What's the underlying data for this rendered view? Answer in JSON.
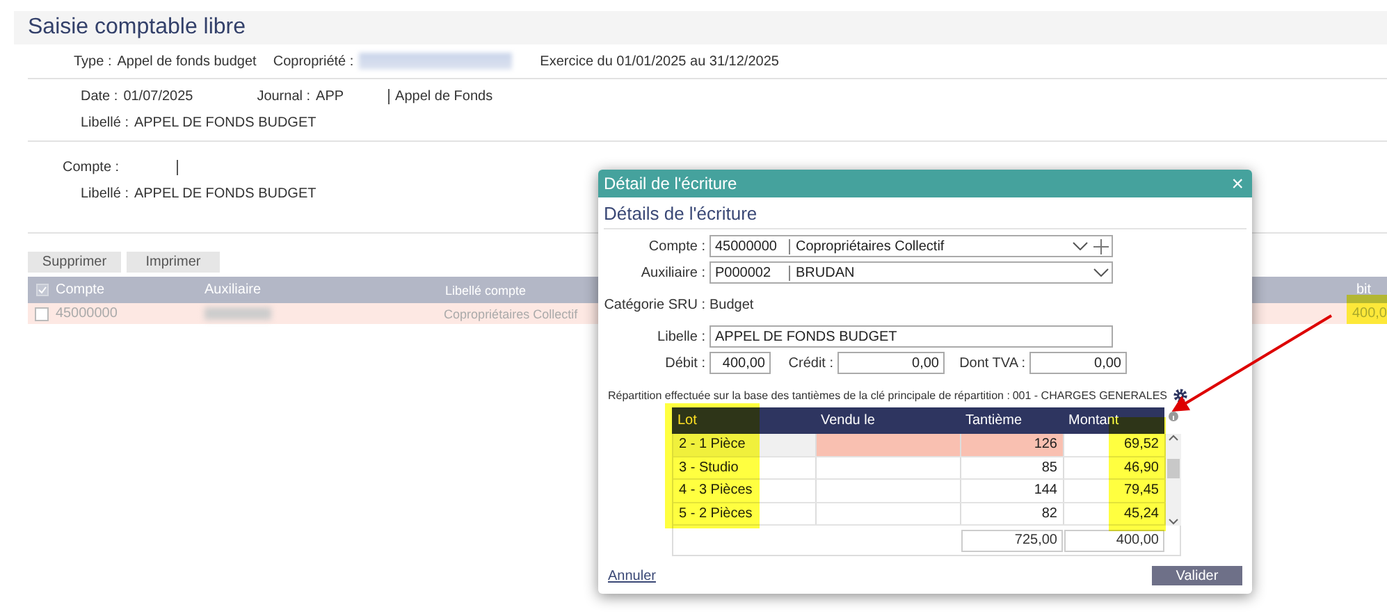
{
  "page": {
    "title": "Saisie comptable libre",
    "type": {
      "label": "Type :",
      "value": "Appel de fonds budget"
    },
    "copropriete": {
      "label": "Copropriété :"
    },
    "exercice": "Exercice du 01/01/2025 au 31/12/2025",
    "date": {
      "label": "Date :",
      "value": "01/07/2025"
    },
    "journal": {
      "label": "Journal :",
      "value": "APP",
      "name": "Appel de Fonds"
    },
    "libelle": {
      "label": "Libellé :",
      "value": "APPEL DE FONDS BUDGET"
    },
    "compte": {
      "label": "Compte :"
    },
    "libelle_ligne": {
      "label": "Libellé :",
      "value": "APPEL DE FONDS BUDGET"
    },
    "actions": [
      "Supprimer",
      "Imprimer"
    ],
    "table": {
      "columns": [
        "Compte",
        "Auxiliaire",
        "Libellé compte",
        "bit"
      ],
      "rows": [
        {
          "compte": "45000000",
          "libelle_compte": "Copropriétaires Collectif",
          "column_4": "400,0",
          "checked": false,
          "selected": true
        }
      ]
    }
  },
  "dialog": {
    "title": "Détail de l'écriture",
    "close": "×",
    "heading": "Détails de l'écriture",
    "compte": {
      "label": "Compte :",
      "code": "45000000",
      "name": "Copropriétaires Collectif"
    },
    "auxiliaire": {
      "label": "Auxiliaire :",
      "code": "P000002",
      "name": "BRUDAN"
    },
    "categorie": {
      "label": "Catégorie SRU :",
      "value": "Budget"
    },
    "libelle": {
      "label": "Libelle :",
      "value": "APPEL DE FONDS BUDGET"
    },
    "amounts": [
      {
        "label": "Débit :",
        "value": "400,00"
      },
      {
        "label": "Crédit :",
        "value": "0,00"
      },
      {
        "label": "Dont TVA :",
        "value": "0,00"
      }
    ],
    "repartition": {
      "text": "Répartition effectuée sur la base des tantièmes de la clé principale de répartition :",
      "key": "001 - CHARGES GENERALES"
    },
    "grid": {
      "columns": [
        "Lot",
        "Vendu le",
        "Tantième",
        "Montant"
      ],
      "rows": [
        {
          "lot": "2 - 1 Pièce",
          "tantieme": "126",
          "montant": "69,52",
          "selected": true
        },
        {
          "lot": "3 - Studio",
          "tantieme": "85",
          "montant": "46,90",
          "selected": false
        },
        {
          "lot": "4 - 3 Pièces",
          "tantieme": "144",
          "montant": "79,45",
          "selected": false
        },
        {
          "lot": "5 - 2 Pièces",
          "tantieme": "82",
          "montant": "45,24",
          "selected": false
        }
      ],
      "totals": [
        "725,00",
        "400,00"
      ]
    },
    "cancel": "Annuler",
    "confirm": "Valider"
  }
}
